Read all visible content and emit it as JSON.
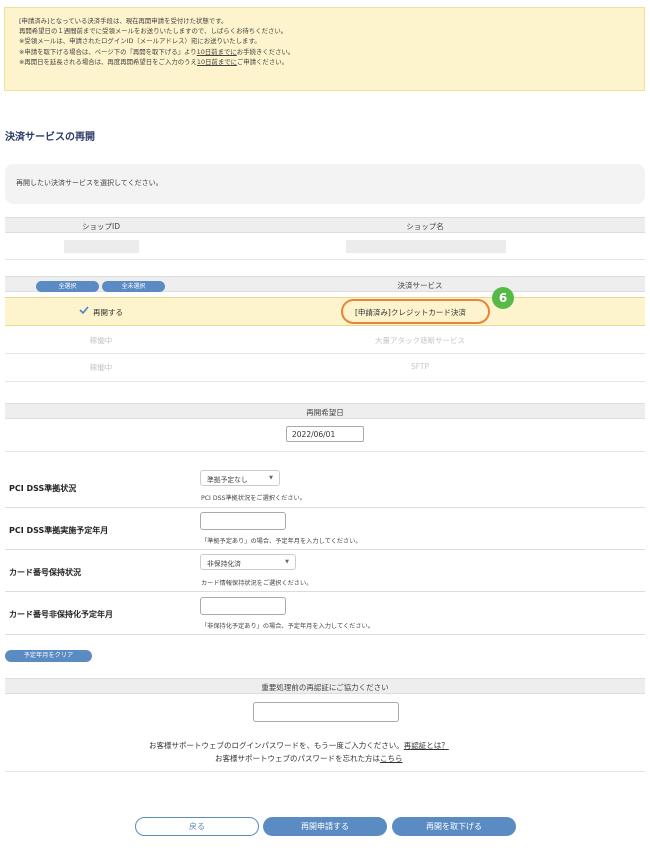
{
  "notice": {
    "lines": [
      "[申請済み]となっている決済手段は、現在再開申請を受付けた状態です。",
      "再開希望日の１週間前までに受領メールをお送りいたしますので、しばらくお待ちください。",
      "※受領メールは、申請されたログインID（メールアドレス）宛にお送りいたします。",
      {
        "before": "※申請を取下げる場合は、ページ下の『再開を取下げる』より",
        "underline": "10日前までに",
        "after": "お手続きください。"
      },
      {
        "before": "※再開日を延長される場合は、再度再開希望日をご入力のうえ",
        "underline": "10日前までに",
        "after": "ご申請ください。"
      }
    ]
  },
  "section_title": "決済サービスの再開",
  "instruction": "再開したい決済サービスを選択してください。",
  "shop_table": {
    "col_id": "ショップID",
    "col_name": "ショップ名"
  },
  "service_table": {
    "select_all": "全選択",
    "deselect_all": "全未選択",
    "header": "決済サービス",
    "selected_row": {
      "status": "再開する",
      "service": "[申請済み]クレジットカード決済",
      "badge": "6"
    },
    "disabled_rows": [
      {
        "status": "稼働中",
        "service": "大量アタック遮断サービス"
      },
      {
        "status": "稼働中",
        "service": "SFTP"
      }
    ]
  },
  "restart_date": {
    "header": "再開希望日",
    "value": "2022/06/01"
  },
  "form": {
    "pci_status": {
      "label": "PCI DSS準拠状況",
      "value": "準拠予定なし",
      "hint": "PCI DSS準拠状況をご選択ください。"
    },
    "pci_date": {
      "label": "PCI DSS準拠実施予定年月",
      "hint": "「準拠予定あり」の場合、予定年月を入力してください。"
    },
    "card_status": {
      "label": "カード番号保持状況",
      "value": "非保持化済",
      "hint": "カード情報保持状況をご選択ください。"
    },
    "card_date": {
      "label": "カード番号非保持化予定年月",
      "hint": "「非保持化予定あり」の場合、予定年月を入力してください。"
    },
    "clear_button": "予定年月をクリア"
  },
  "reauth": {
    "header": "重要処理前の再認証にご協力ください",
    "line1": "お客様サポートウェブのログインパスワードを、もう一度ご入力ください。",
    "line1_link": "再認証とは？",
    "line2": "お客様サポートウェブのパスワードを忘れた方は",
    "line2_link": "こちら"
  },
  "buttons": {
    "back": "戻る",
    "apply": "再開申請する",
    "withdraw": "再開を取下げる"
  },
  "colors": {
    "accent": "#5a8bc2",
    "highlight_ring": "#e8833a",
    "badge": "#56b948",
    "notice_bg": "#fdf3cc"
  }
}
